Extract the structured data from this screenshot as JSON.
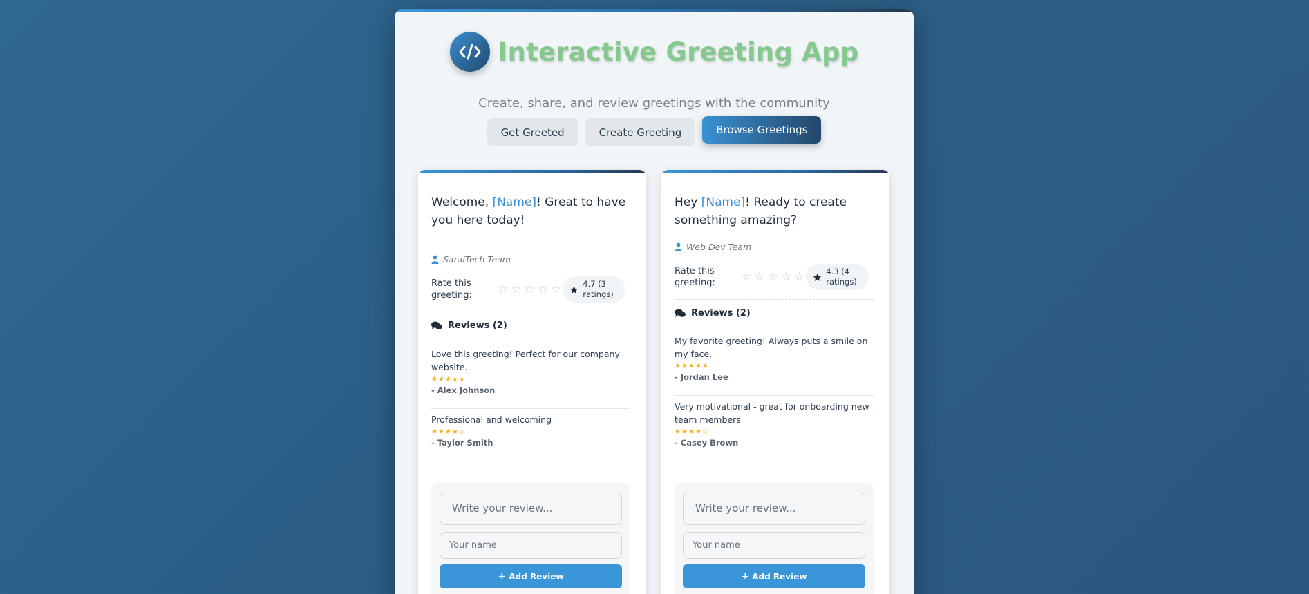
{
  "app": {
    "title": "Interactive Greeting App",
    "subtitle": "Create, share, and review greetings with the community",
    "logo_icon": "code-icon"
  },
  "nav": {
    "tabs": [
      {
        "label": "Get Greeted",
        "active": false
      },
      {
        "label": "Create Greeting",
        "active": false
      },
      {
        "label": "Browse Greetings",
        "active": true
      }
    ]
  },
  "cards": [
    {
      "text_before": "Welcome, ",
      "placeholder": "[Name]",
      "text_after": "! Great to have you here today!",
      "author": "SaralTech Team",
      "rate_label": "Rate this greeting:",
      "rating_summary": "4.7 (3 ratings)",
      "reviews_heading": "Reviews (2)",
      "reviews": [
        {
          "text": "Love this greeting! Perfect for our company website.",
          "stars": "★★★★★",
          "rating": 5,
          "author": "- Alex Johnson"
        },
        {
          "text": "Professional and welcoming",
          "stars": "★★★★☆",
          "rating": 4,
          "author": "- Taylor Smith"
        }
      ],
      "review_placeholder": "Write your review...",
      "name_placeholder": "Your name",
      "add_label": "Add Review"
    },
    {
      "text_before": "Hey ",
      "placeholder": "[Name]",
      "text_after": "! Ready to create something amazing?",
      "author": "Web Dev Team",
      "rate_label": "Rate this greeting:",
      "rating_summary": "4.3 (4 ratings)",
      "reviews_heading": "Reviews (2)",
      "reviews": [
        {
          "text": "My favorite greeting! Always puts a smile on my face.",
          "stars": "★★★★★",
          "rating": 5,
          "author": "- Jordan Lee"
        },
        {
          "text": "Very motivational - great for onboarding new team members",
          "stars": "★★★★☆",
          "rating": 4,
          "author": "- Casey Brown"
        }
      ],
      "review_placeholder": "Write your review...",
      "name_placeholder": "Your name",
      "add_label": "Add Review"
    }
  ],
  "colors": {
    "accent": "#3a95d9",
    "title": "#86c98e",
    "star": "#f2b01e"
  }
}
